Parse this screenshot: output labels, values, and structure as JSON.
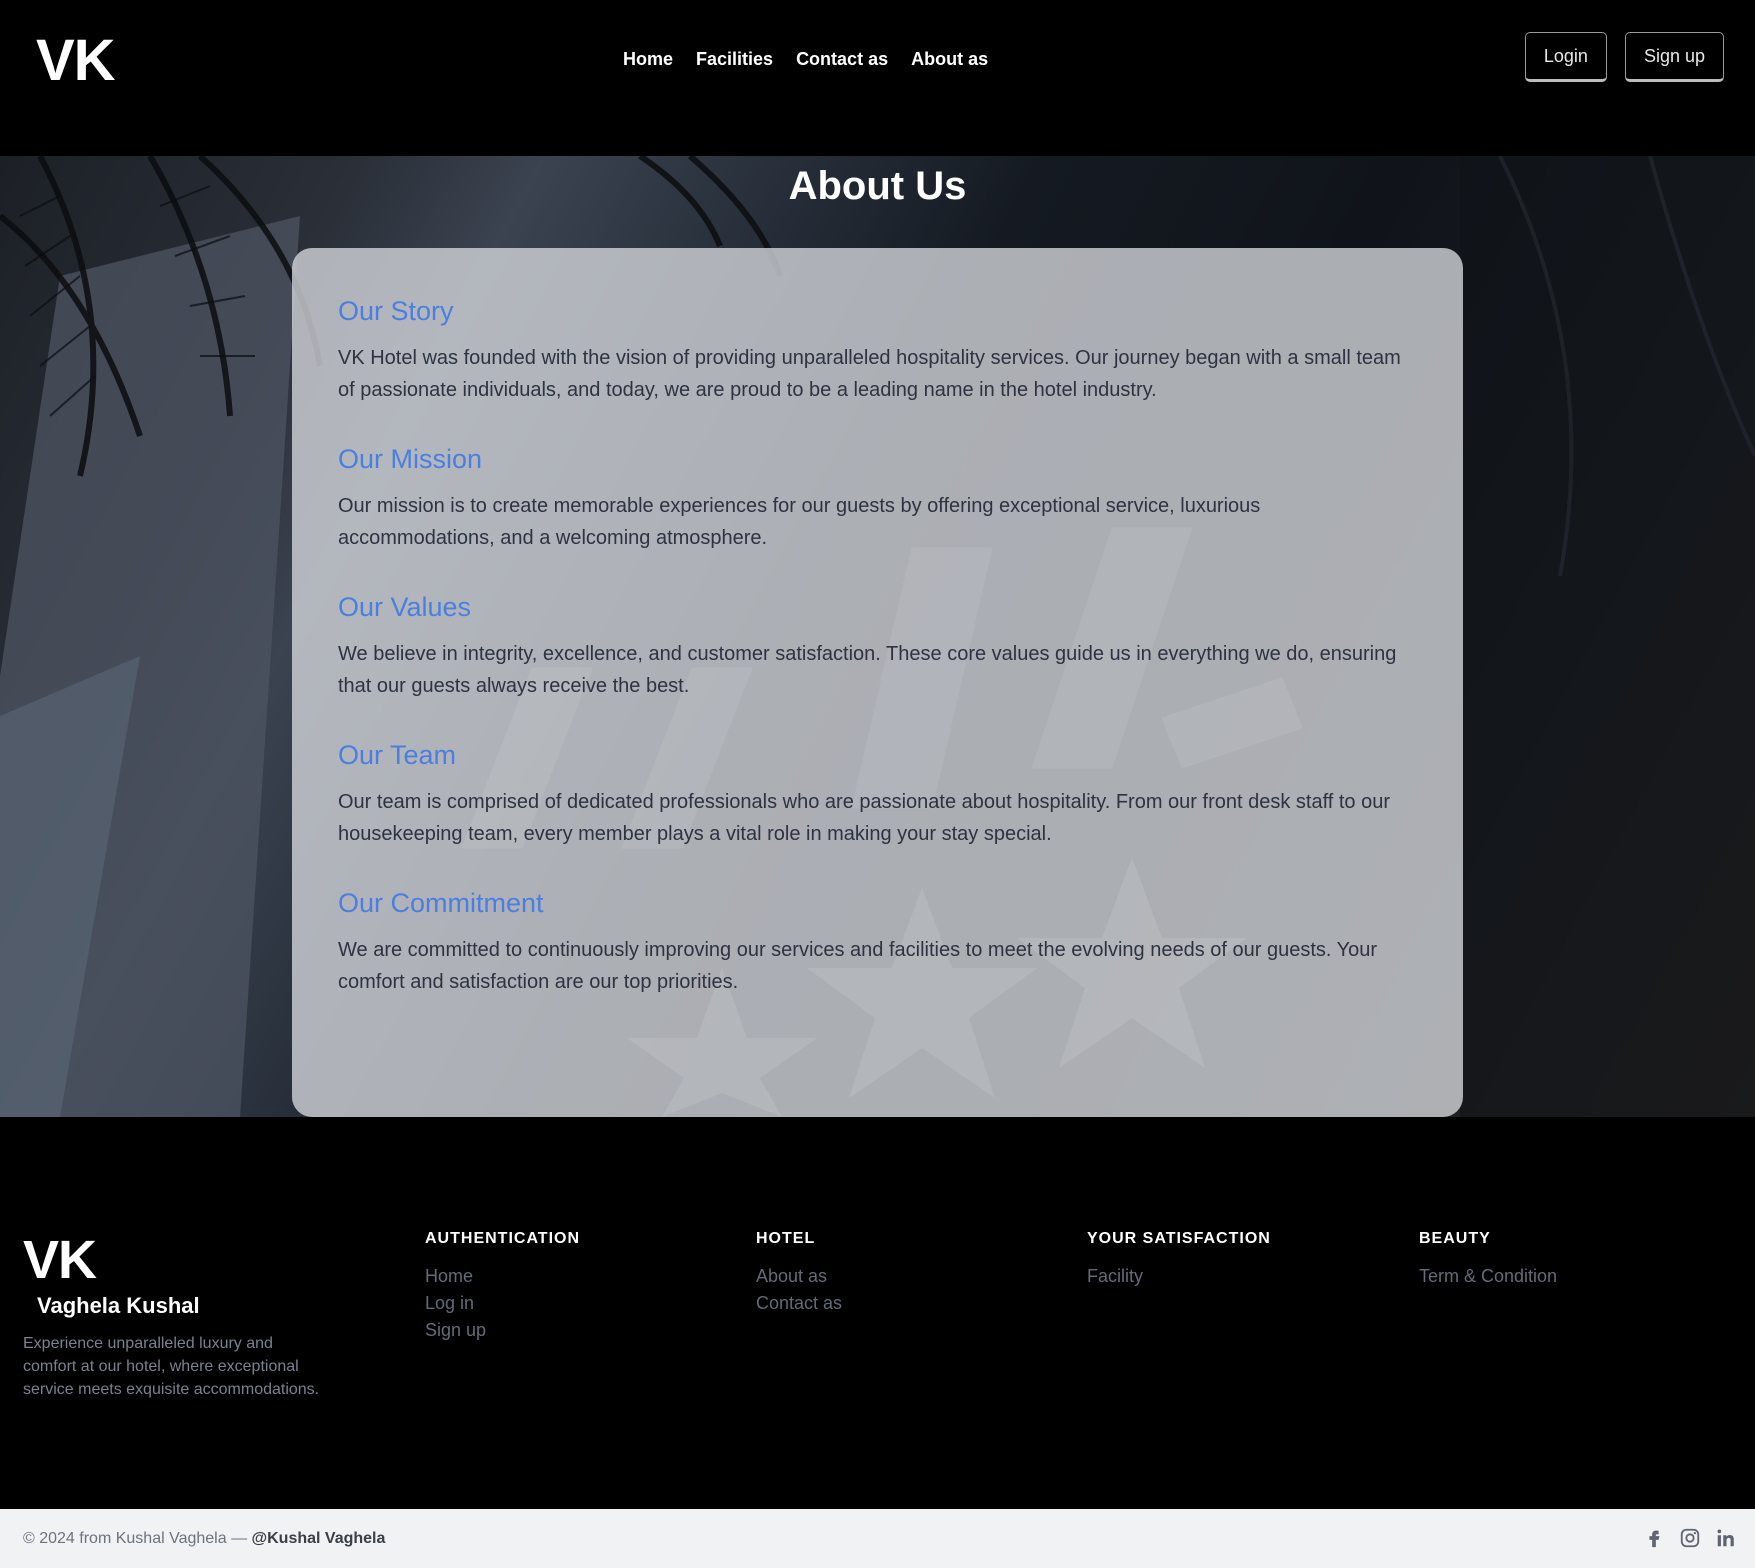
{
  "header": {
    "logo": "VK",
    "nav": [
      "Home",
      "Facilities",
      "Contact as",
      "About as"
    ],
    "login": "Login",
    "signup": "Sign up"
  },
  "hero": {
    "title": "About Us"
  },
  "sections": [
    {
      "title": "Our Story",
      "text": "VK Hotel was founded with the vision of providing unparalleled hospitality services. Our journey began with a small team of passionate individuals, and today, we are proud to be a leading name in the hotel industry."
    },
    {
      "title": "Our Mission",
      "text": "Our mission is to create memorable experiences for our guests by offering exceptional service, luxurious accommodations, and a welcoming atmosphere."
    },
    {
      "title": "Our Values",
      "text": "We believe in integrity, excellence, and customer satisfaction. These core values guide us in everything we do, ensuring that our guests always receive the best."
    },
    {
      "title": "Our Team",
      "text": "Our team is comprised of dedicated professionals who are passionate about hospitality. From our front desk staff to our housekeeping team, every member plays a vital role in making your stay special."
    },
    {
      "title": "Our Commitment",
      "text": "We are committed to continuously improving our services and facilities to meet the evolving needs of our guests. Your comfort and satisfaction are our top priorities."
    }
  ],
  "footer": {
    "logo": "VK",
    "name": "Vaghela Kushal",
    "description": "Experience unparalleled luxury and comfort at our hotel, where exceptional service meets exquisite accommodations.",
    "columns": [
      {
        "heading": "AUTHENTICATION",
        "links": [
          "Home",
          "Log in",
          "Sign up"
        ]
      },
      {
        "heading": "HOTEL",
        "links": [
          "About as",
          "Contact as"
        ]
      },
      {
        "heading": "YOUR SATISFACTION",
        "links": [
          "Facility"
        ]
      },
      {
        "heading": "BEAUTY",
        "links": [
          "Term & Condition"
        ]
      }
    ]
  },
  "bottom": {
    "copyright": "© 2024 from Kushal Vaghela —",
    "handle": "@Kushal Vaghela",
    "social_icons": [
      "facebook-icon",
      "instagram-icon",
      "linkedin-icon"
    ]
  },
  "colors": {
    "accent": "#4a7fe0",
    "header_bg": "#000000",
    "bottom_bar_bg": "#f1f2f4"
  }
}
